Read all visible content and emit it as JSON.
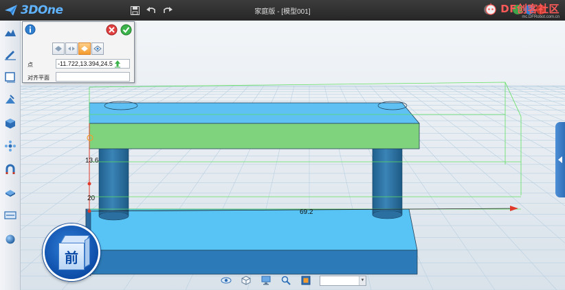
{
  "app": {
    "logo_text": "3DOne",
    "document_title": "家庭版 - [模型001]"
  },
  "watermark": {
    "brand": "DF创客社区",
    "url": "mc.DFRobot.com.cn"
  },
  "toolbar": {
    "icons": [
      "save-icon",
      "undo-icon",
      "redo-icon"
    ]
  },
  "left_toolbar": {
    "items": [
      "basic-solid-icon",
      "sketch-draw-icon",
      "sketch-edit-icon",
      "special-feature-icon",
      "combine-icon",
      "move-icon",
      "magnet-icon",
      "paint-icon",
      "distance-icon",
      "material-sphere-icon"
    ]
  },
  "dialog": {
    "info_icon": "info-icon",
    "cancel_icon": "cancel-icon",
    "confirm_icon": "confirm-icon",
    "mode_buttons": [
      "point-mode-1",
      "point-mode-2",
      "point-mode-3",
      "point-mode-4"
    ],
    "active_mode_index": 2,
    "point_label": "点",
    "point_value": "-11.722,13.394,24.5",
    "align_label": "对齐平面",
    "align_value": ""
  },
  "viewport": {
    "dimension_height": "13.6",
    "dimension_offset": "20",
    "dimension_length": "69.2",
    "colors": {
      "grid": "#b8cfe0",
      "bar_top": "#5ec0f3",
      "bar_front": "#7fd37d",
      "pillar": "#2e6f9c",
      "base_top": "#58c4f5",
      "base_front": "#2c7bb8",
      "bounding_box": "#5fe05f",
      "axis": "#e03a2a"
    }
  },
  "view_cube": {
    "face_label": "前"
  },
  "bottom_toolbar": {
    "icons": [
      "eye-icon",
      "view-cube-icon",
      "display-mode-icon",
      "zoom-icon",
      "render-icon"
    ],
    "render_select_value": ""
  }
}
